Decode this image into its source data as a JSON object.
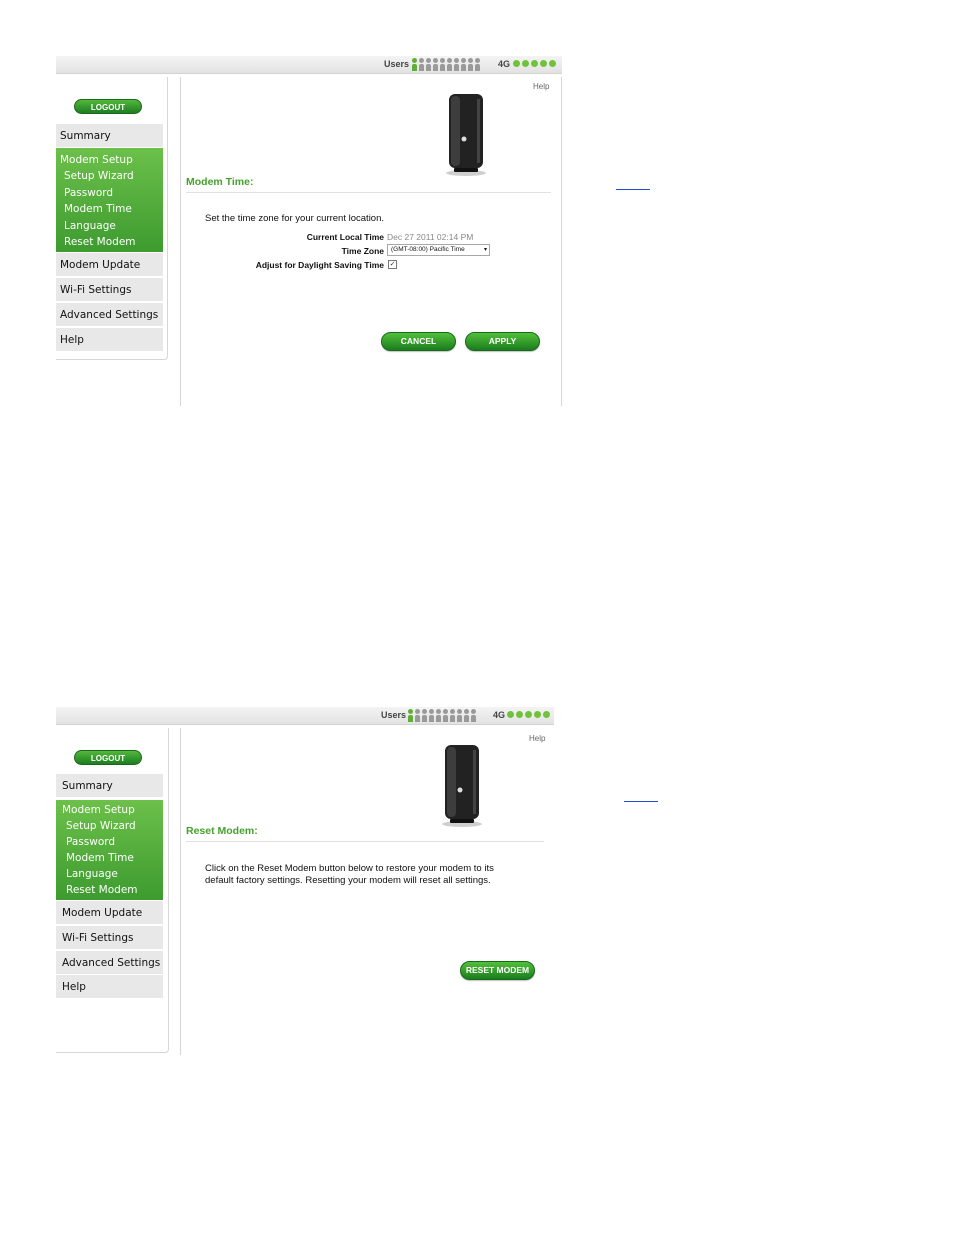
{
  "status_bar": {
    "users_label": "Users",
    "users_total": 10,
    "users_active": 1,
    "network_label": "4G",
    "signal_dots": 5,
    "colors": {
      "active": "#5fae38",
      "inactive": "#9a9a9a",
      "signal": "#6fc23a"
    }
  },
  "sidebar": {
    "logout_label": "LOGOUT",
    "summary": "Summary",
    "modem_setup": {
      "title": "Modem Setup",
      "items": [
        "Setup Wizard",
        "Password",
        "Modem Time",
        "Language",
        "Reset Modem"
      ]
    },
    "modem_update": "Modem Update",
    "wifi_settings": "Wi-Fi Settings",
    "advanced_settings": "Advanced Settings",
    "help": "Help"
  },
  "modem_time_page": {
    "help_link": "Help",
    "title": "Modem Time:",
    "instruction": "Set the time zone for your current location.",
    "current_time_label": "Current Local Time",
    "current_time_value": "Dec 27 2011 02:14 PM",
    "time_zone_label": "Time Zone",
    "time_zone_value": "(GMT-08:00) Pacific Time",
    "dst_label": "Adjust for Daylight Saving Time",
    "dst_checked": true,
    "cancel_label": "CANCEL",
    "apply_label": "APPLY"
  },
  "reset_modem_page": {
    "help_link": "Help",
    "title": "Reset Modem:",
    "line1": "Click on the Reset Modem button below to restore your modem to its",
    "line2": "default factory settings. Resetting your modem will reset all settings.",
    "reset_label": "RESET MODEM"
  },
  "theme": {
    "accent_green": "#45a12c",
    "nav_green": "#5ab33d",
    "nav_gray": "#e8e8e8"
  }
}
